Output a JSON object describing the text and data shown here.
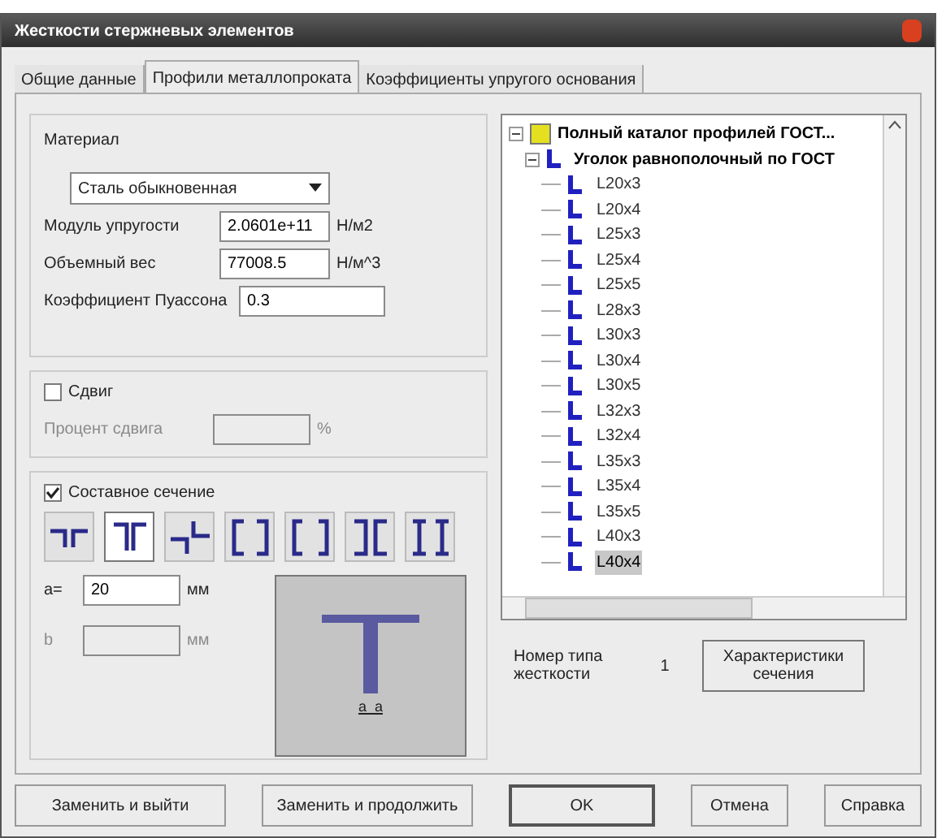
{
  "window": {
    "title": "Жесткости стержневых элементов"
  },
  "tabs": [
    {
      "label": "Общие данные",
      "selected": false
    },
    {
      "label": "Профили металлопроката",
      "selected": true
    },
    {
      "label": "Коэффициенты упругого основания",
      "selected": false
    }
  ],
  "material": {
    "title": "Материал",
    "select": "Сталь обыкновенная",
    "fields": [
      {
        "label": "Модуль упругости",
        "value": "2.0601e+11",
        "unit": "Н/м2"
      },
      {
        "label": "Объемный вес",
        "value": "77008.5",
        "unit": "Н/м^3"
      },
      {
        "label": "Коэффициент Пуассона",
        "value": "0.3"
      }
    ]
  },
  "shear": {
    "label": "Сдвиг",
    "checked": false,
    "field_label": "Процент сдвига",
    "unit": "%"
  },
  "composite": {
    "label": "Составное сечение",
    "checked": true,
    "sections": [
      {
        "kind": "angles-flat",
        "selected": false
      },
      {
        "kind": "angles-tee",
        "selected": true
      },
      {
        "kind": "angles-cross",
        "selected": false
      },
      {
        "kind": "channels-box",
        "selected": false
      },
      {
        "kind": "channels-box-gap",
        "selected": false
      },
      {
        "kind": "channels-back",
        "selected": false
      },
      {
        "kind": "channels-face",
        "selected": false
      }
    ],
    "fields": [
      {
        "label": "a=",
        "value": "20",
        "unit": "мм",
        "disabled": false
      },
      {
        "label": "b",
        "unit": "мм",
        "disabled": true
      }
    ],
    "preview_label": "a  a"
  },
  "tree": {
    "label": "Полный каталог профилей ГОСТ...",
    "expanded": true,
    "children": [
      {
        "label": "Уголок равнополочный по ГОСТ",
        "expanded": true,
        "children": [
          {
            "label": "L20x3",
            "selected": false
          },
          {
            "label": "L20x4",
            "selected": false
          },
          {
            "label": "L25x3",
            "selected": false
          },
          {
            "label": "L25x4",
            "selected": false
          },
          {
            "label": "L25x5",
            "selected": false
          },
          {
            "label": "L28x3",
            "selected": false
          },
          {
            "label": "L30x3",
            "selected": false
          },
          {
            "label": "L30x4",
            "selected": false
          },
          {
            "label": "L30x5",
            "selected": false
          },
          {
            "label": "L32x3",
            "selected": false
          },
          {
            "label": "L32x4",
            "selected": false
          },
          {
            "label": "L35x3",
            "selected": false
          },
          {
            "label": "L35x4",
            "selected": false
          },
          {
            "label": "L35x5",
            "selected": false
          },
          {
            "label": "L40x3",
            "selected": false
          },
          {
            "label": "L40x4",
            "selected": true
          }
        ]
      }
    ]
  },
  "stiffness": {
    "label": "Номер типа жесткости",
    "value": "1"
  },
  "section_button": "Характеристики сечения",
  "buttons": [
    {
      "label": "Заменить и выйти",
      "default": false
    },
    {
      "label": "Заменить и продолжить",
      "default": false
    },
    {
      "label": "OK",
      "default": true
    },
    {
      "label": "Отмена",
      "default": false
    },
    {
      "label": "Справка",
      "default": false
    }
  ]
}
